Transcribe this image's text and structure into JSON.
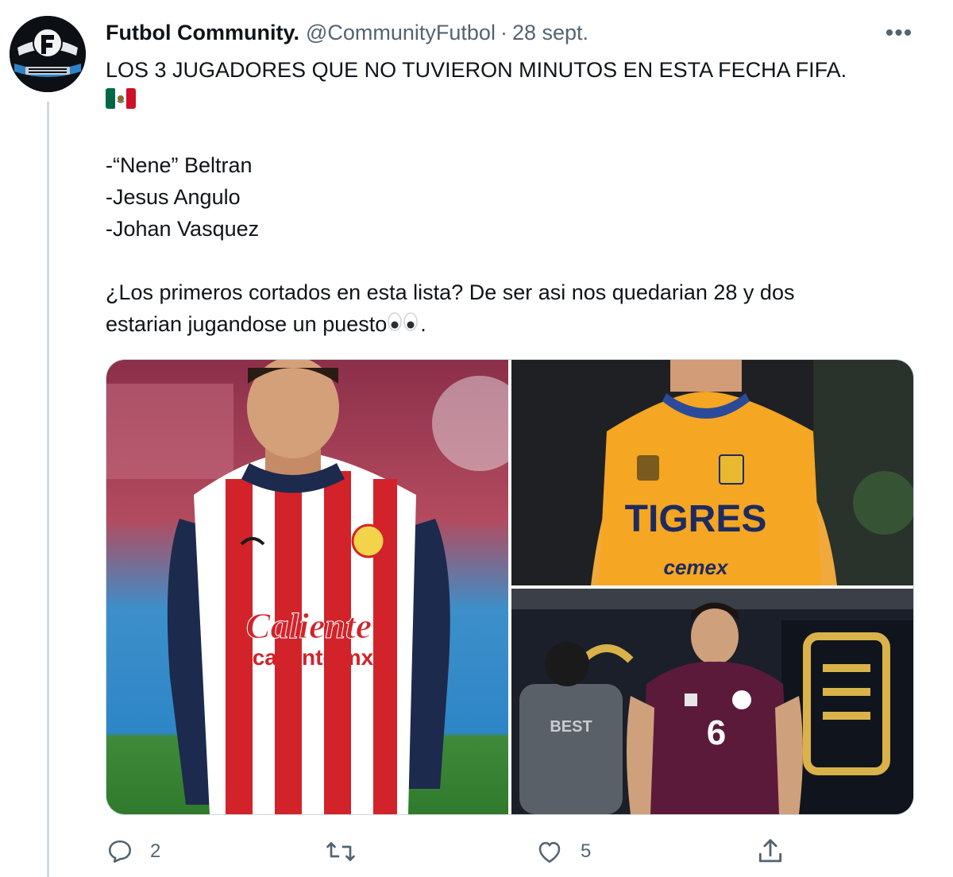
{
  "tweet": {
    "author_name": "Futbol Community.",
    "handle": "@CommunityFutbol",
    "separator": "·",
    "date": "28 sept.",
    "more_label": "•••",
    "text_line1": "LOS 3 JUGADORES QUE NO TUVIERON MINUTOS EN ESTA FECHA FIFA.",
    "flag_icon": "mexico-flag",
    "list": [
      "-“Nene” Beltran",
      "-Jesus Angulo",
      "-Johan Vasquez"
    ],
    "question_line1": "¿Los primeros cortados en esta lista?   De ser asi nos quedarian 28 y dos",
    "question_line2": "estarian jugandose un puesto",
    "question_end": ".",
    "eyes_icon": "eyes-emoji",
    "media_count": 3,
    "media": [
      {
        "name": "chivas-player-photo",
        "jersey_text": "Caliente",
        "jersey_subtext": "caliente.mx"
      },
      {
        "name": "tigres-player-photo",
        "jersey_text": "TIGRES",
        "sponsor": "cemex"
      },
      {
        "name": "mexico-player-photo",
        "jersey_number": "6",
        "background_text": "BEST"
      }
    ]
  },
  "actions": {
    "reply_count": "2",
    "retweet_count": "",
    "like_count": "5",
    "share_count": ""
  },
  "colors": {
    "text": "#0f1419",
    "secondary": "#536471",
    "thread_line": "#cfd9de",
    "chivas_red": "#d2232a",
    "chivas_blue": "#1c2a4d",
    "tigres_yellow": "#f5a623",
    "mexico_maroon": "#5b1a3a"
  }
}
